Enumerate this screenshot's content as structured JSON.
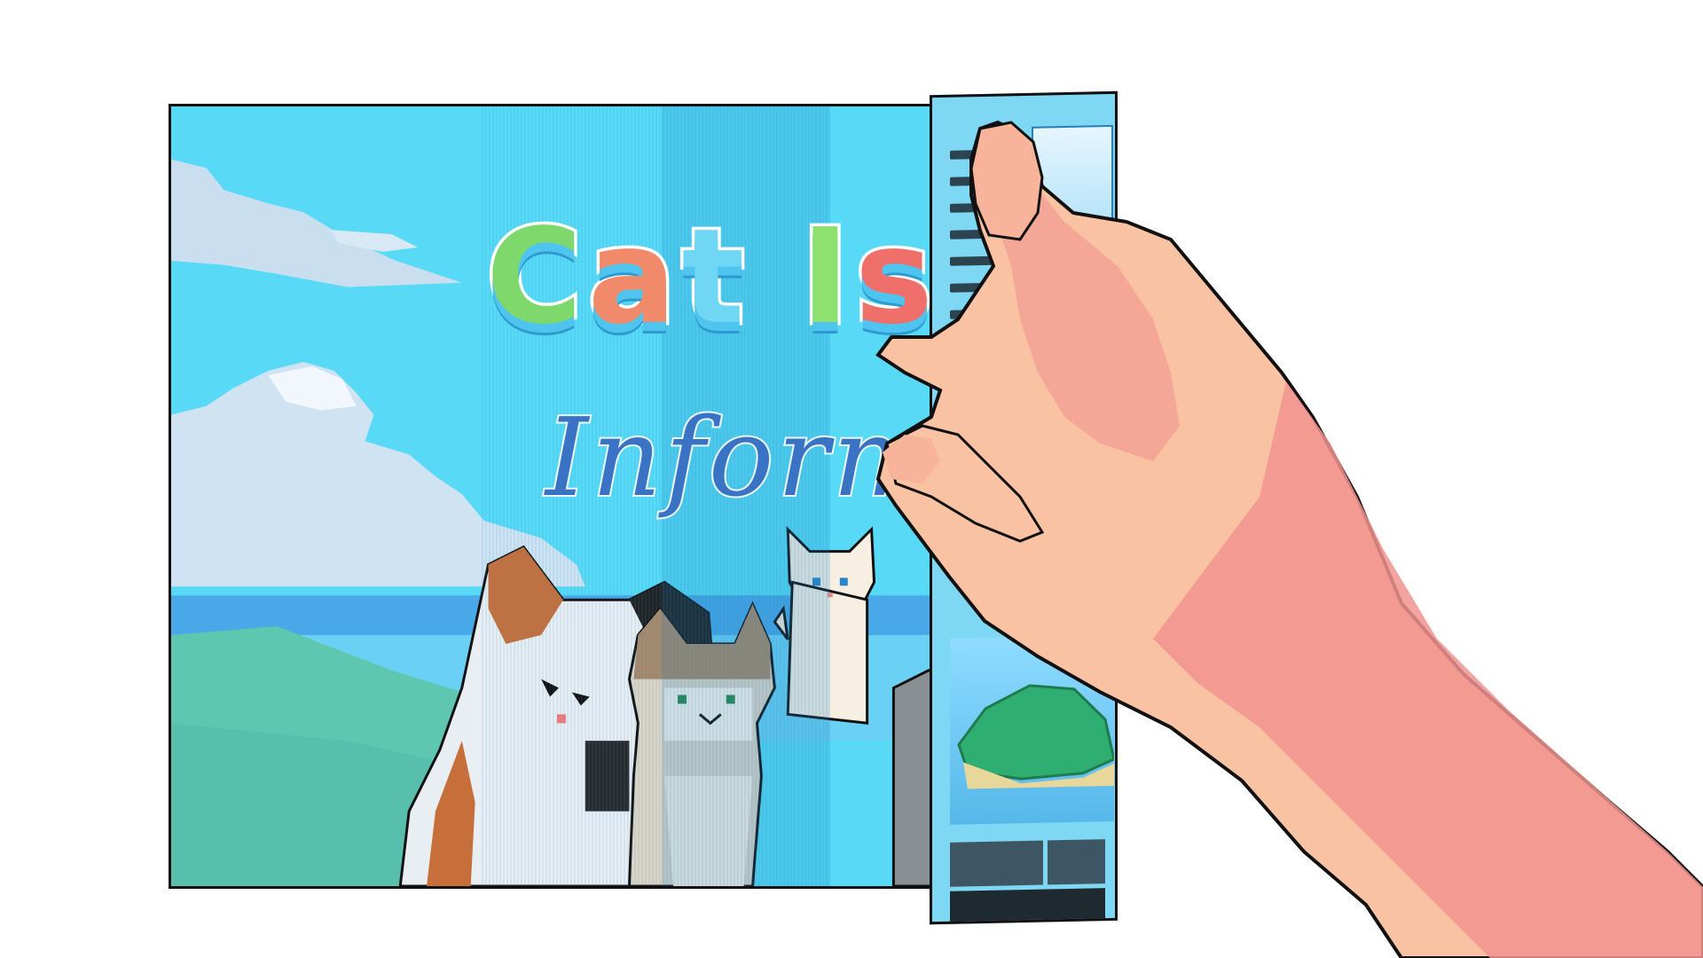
{
  "scene": {
    "description_label": "",
    "brochure": {
      "title_line1": [
        "C",
        "a",
        "t",
        " ",
        "I",
        "s"
      ],
      "title_line2": "Inform",
      "colors": {
        "sky": "#58daf7",
        "ocean": "#5ab8f0",
        "grass": "#5fc7b0",
        "title_green": "#7fd86b",
        "title_orange": "#f08a6b",
        "title_blue": "#6fd6f4",
        "title_red": "#ef6f6b",
        "subtitle_blue": "#3a73c4"
      }
    },
    "back_panel": {
      "colors": {
        "panel": "#7ed8f4",
        "text": "#1d2a33",
        "island": "#2fae72"
      }
    },
    "hand": {
      "colors": {
        "skin": "#f9c3a3",
        "skin_shadow": "#f2948f",
        "outline": "#111111"
      }
    },
    "cats": [
      {
        "name": "calico-cat",
        "icon": "cat-calico"
      },
      {
        "name": "tabby-cat",
        "icon": "cat-tabby"
      },
      {
        "name": "white-cat",
        "icon": "cat-white"
      },
      {
        "name": "grey-cat",
        "icon": "cat-grey"
      }
    ]
  }
}
